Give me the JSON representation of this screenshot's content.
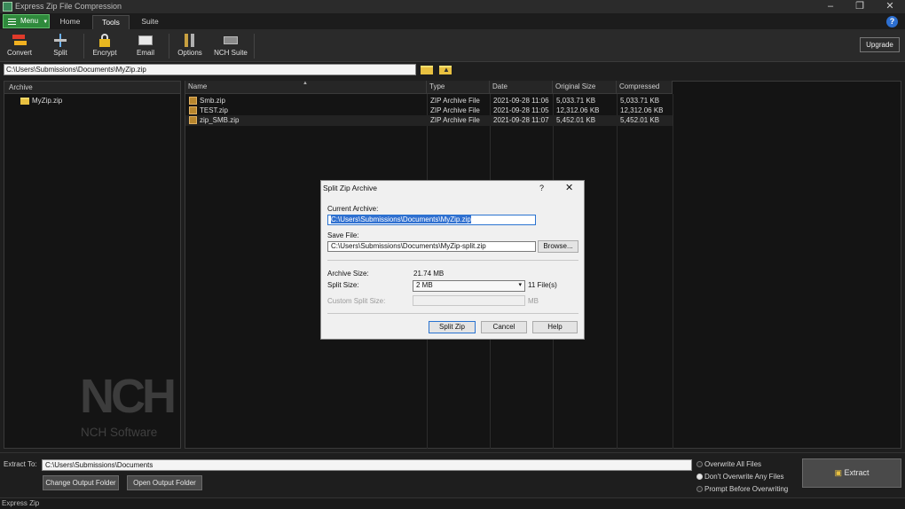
{
  "window": {
    "title": "Express Zip File Compression"
  },
  "menu": {
    "label": "Menu"
  },
  "tabs": [
    "Home",
    "Tools",
    "Suite"
  ],
  "toolbar": {
    "items": [
      "Convert",
      "Split",
      "Encrypt",
      "Email",
      "Options",
      "NCH Suite"
    ],
    "upgrade": "Upgrade"
  },
  "path": "C:\\Users\\Submissions\\Documents\\MyZip.zip",
  "archive_panel": {
    "header": "Archive",
    "items": [
      "MyZip.zip"
    ]
  },
  "file_list": {
    "columns": [
      "Name",
      "Type",
      "Date",
      "Original Size",
      "Compressed"
    ],
    "rows": [
      {
        "name": "Smb.zip",
        "type": "ZIP Archive File",
        "date": "2021-09-28 11:06",
        "original": "5,033.71 KB",
        "compressed": "5,033.71 KB"
      },
      {
        "name": "TEST.zip",
        "type": "ZIP Archive File",
        "date": "2021-09-28 11:05",
        "original": "12,312.06 KB",
        "compressed": "12,312.06 KB"
      },
      {
        "name": "zip_SMB.zip",
        "type": "ZIP Archive File",
        "date": "2021-09-28 11:07",
        "original": "5,452.01 KB",
        "compressed": "5,452.01 KB"
      }
    ]
  },
  "logo": {
    "mark": "NCH",
    "text": "NCH Software"
  },
  "dialog": {
    "title": "Split Zip Archive",
    "help": "?",
    "close": "✕",
    "current_archive_label": "Current Archive:",
    "current_archive": "C:\\Users\\Submissions\\Documents\\MyZip.zip",
    "save_file_label": "Save File:",
    "save_file": "C:\\Users\\Submissions\\Documents\\MyZip-split.zip",
    "browse": "Browse...",
    "archive_size_label": "Archive Size:",
    "archive_size": "21.74 MB",
    "split_size_label": "Split Size:",
    "split_size": "2 MB",
    "file_count": "11 File(s)",
    "custom_split_label": "Custom Split Size:",
    "custom_unit": "MB",
    "split_button": "Split Zip",
    "cancel_button": "Cancel",
    "help_button": "Help"
  },
  "extract": {
    "label": "Extract To:",
    "path": "C:\\Users\\Submissions\\Documents",
    "change_output": "Change Output Folder",
    "open_output": "Open Output Folder",
    "options": [
      "Overwrite All Files",
      "Don't Overwrite Any Files",
      "Prompt Before Overwriting"
    ],
    "selected_option": 1,
    "button": "Extract"
  },
  "status": "Express Zip"
}
